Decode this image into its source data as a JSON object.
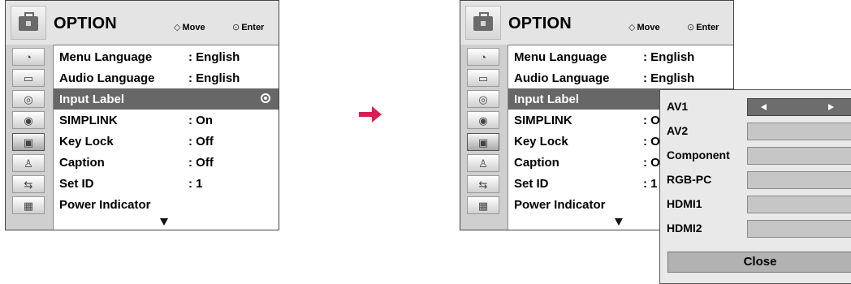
{
  "header": {
    "title": "OPTION",
    "move_label": "Move",
    "enter_label": "Enter"
  },
  "sidebar": {
    "icons": [
      "picture-icon",
      "audio-icon",
      "time-icon",
      "lock-icon",
      "option-icon",
      "input-icon",
      "usb-icon",
      "photo-icon"
    ]
  },
  "menu": {
    "items": [
      {
        "label": "Menu Language",
        "value": ": English"
      },
      {
        "label": "Audio Language",
        "value": ": English"
      },
      {
        "label": "Input Label",
        "value": ""
      },
      {
        "label": "SIMPLINK",
        "value": ": On"
      },
      {
        "label": "Key Lock",
        "value": ": Off"
      },
      {
        "label": "Caption",
        "value": ": Off"
      },
      {
        "label": "Set ID",
        "value": ": 1"
      },
      {
        "label": "Power Indicator",
        "value": ""
      }
    ],
    "right_items": [
      {
        "label": "Menu Language",
        "value": ": English"
      },
      {
        "label": "Audio Language",
        "value": ": English"
      },
      {
        "label": "Input Label",
        "value": ""
      },
      {
        "label": "SIMPLINK",
        "value": ": On"
      },
      {
        "label": "Key Lock",
        "value": ": Of"
      },
      {
        "label": "Caption",
        "value": ": Of"
      },
      {
        "label": "Set ID",
        "value": ": 1"
      },
      {
        "label": "Power Indicator",
        "value": ""
      }
    ]
  },
  "popup": {
    "inputs": [
      "AV1",
      "AV2",
      "Component",
      "RGB-PC",
      "HDMI1",
      "HDMI2"
    ],
    "close_label": "Close"
  },
  "colors": {
    "selected_row": "#676767",
    "arrow": "#d71f55"
  }
}
